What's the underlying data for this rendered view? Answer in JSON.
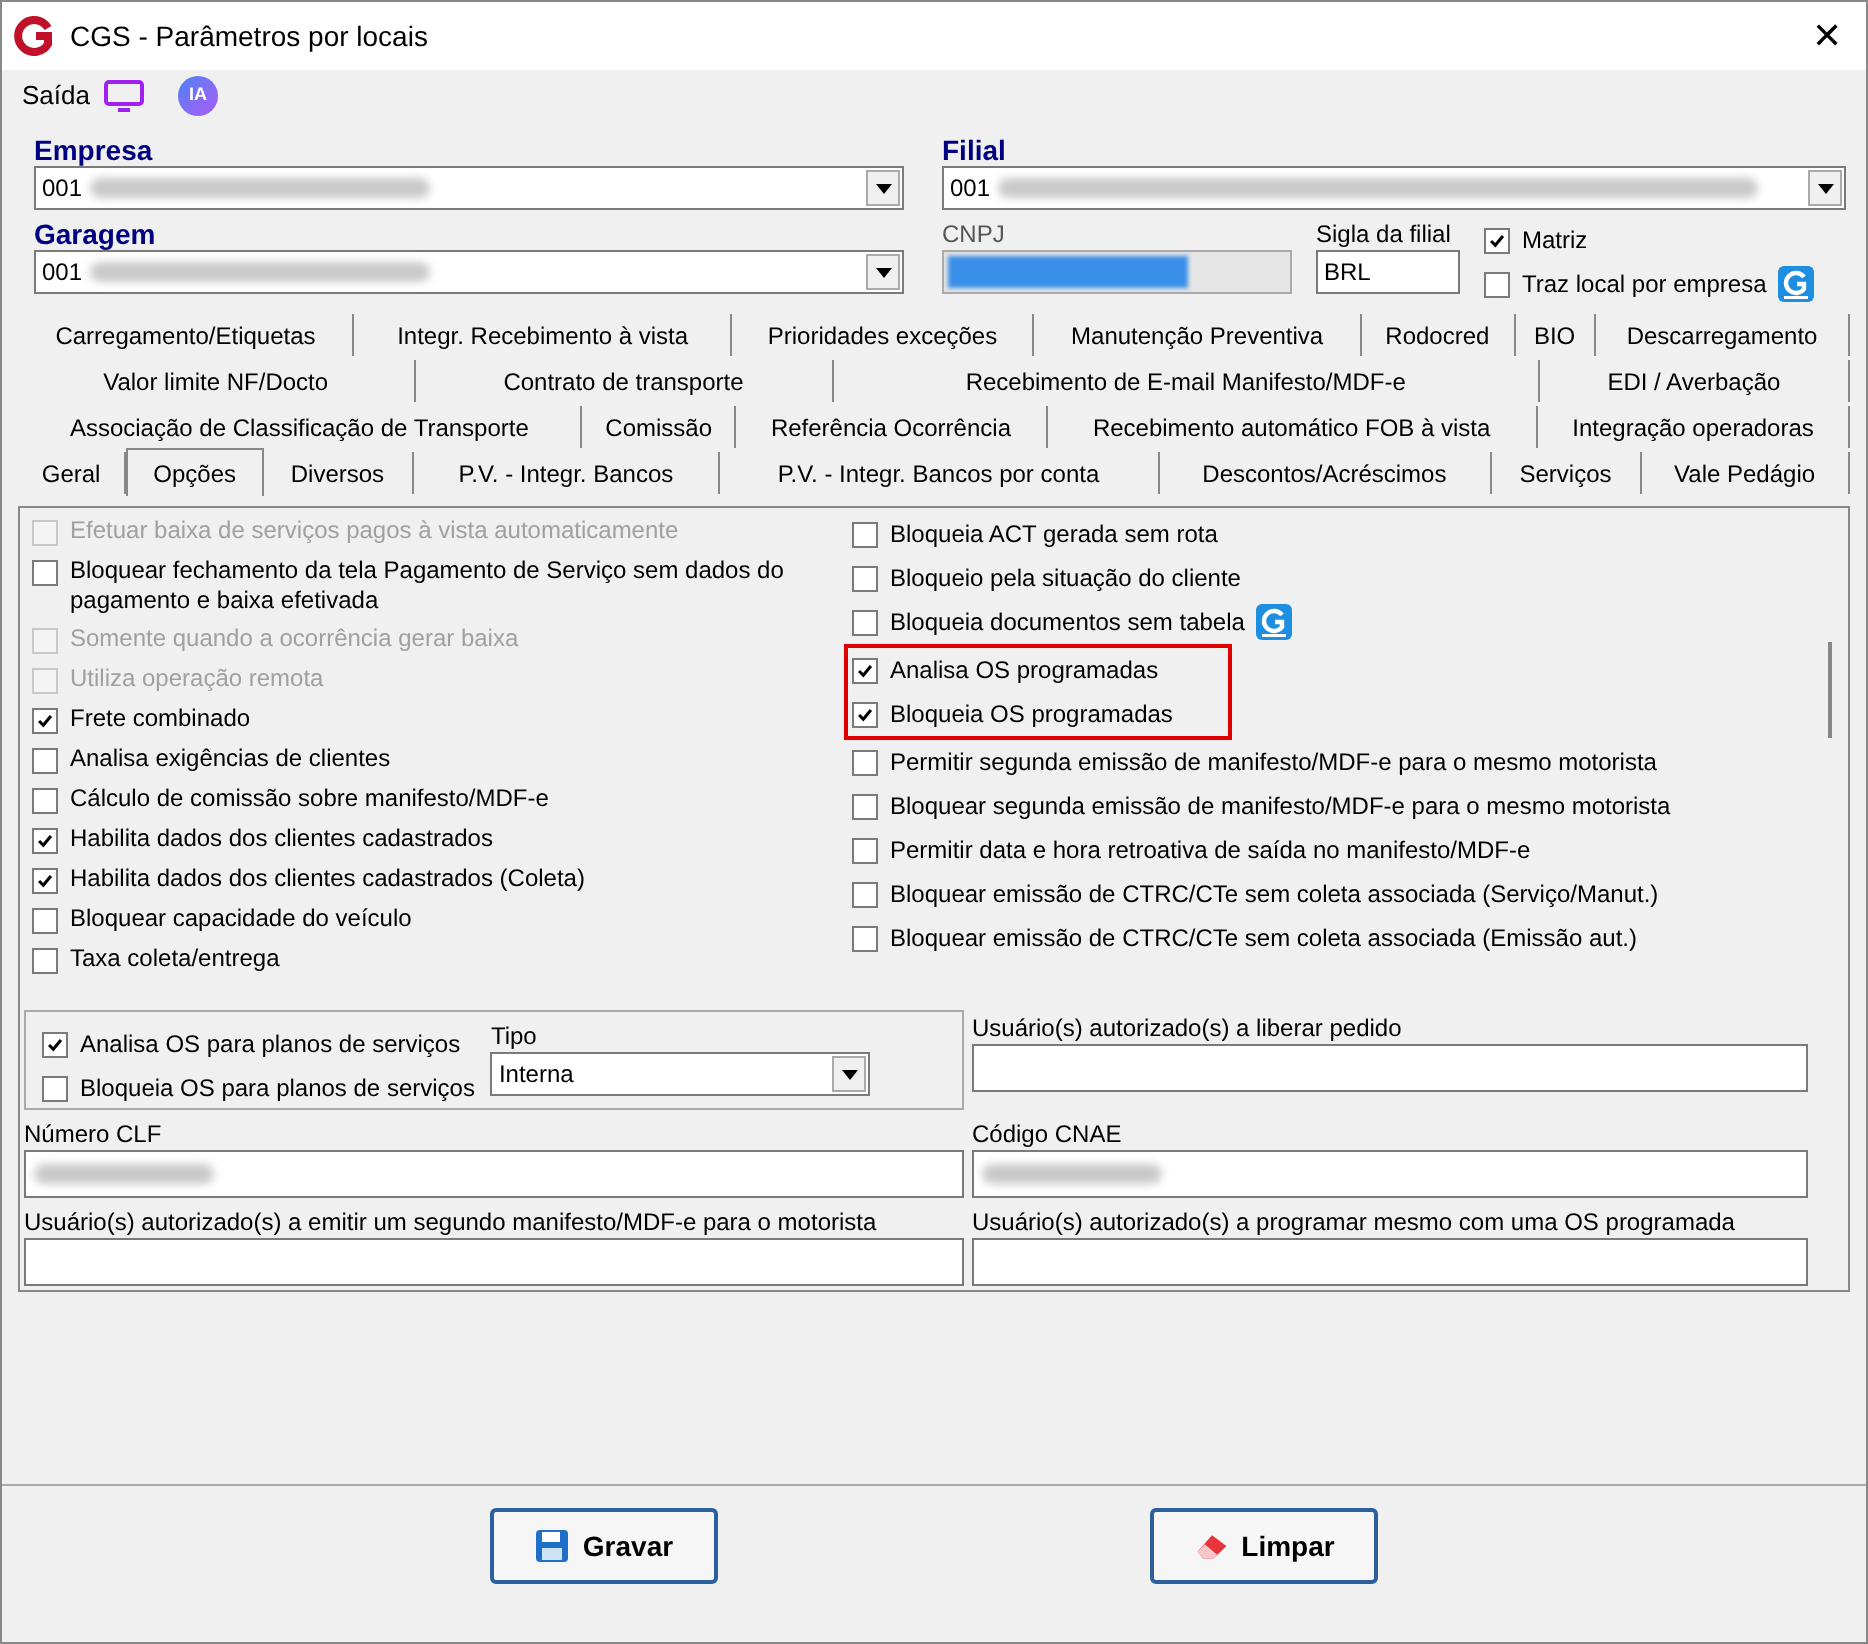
{
  "window": {
    "title": "CGS - Parâmetros por locais",
    "close": "✕"
  },
  "toolbar": {
    "label": "Saída",
    "ia": "IA"
  },
  "fields": {
    "empresa": {
      "label": "Empresa",
      "value": "001"
    },
    "filial": {
      "label": "Filial",
      "value": "001"
    },
    "garagem": {
      "label": "Garagem",
      "value": "001"
    },
    "cnpj": {
      "label": "CNPJ"
    },
    "sigla": {
      "label": "Sigla da filial",
      "value": "BRL"
    },
    "checks": [
      {
        "label": "Matriz",
        "checked": true
      },
      {
        "label": "Traz local por empresa",
        "checked": false
      }
    ]
  },
  "tabs": [
    [
      {
        "label": "Carregamento/Etiquetas",
        "selected": false
      },
      {
        "label": "Integr. Recebimento à vista",
        "selected": false
      },
      {
        "label": "Prioridades exceções",
        "selected": false
      },
      {
        "label": "Manutenção Preventiva",
        "selected": false
      },
      {
        "label": "Rodocred",
        "selected": false
      },
      {
        "label": "BIO",
        "selected": false
      },
      {
        "label": "Descarregamento",
        "selected": false
      }
    ],
    [
      {
        "label": "Valor limite NF/Docto",
        "selected": false
      },
      {
        "label": "Contrato de transporte",
        "selected": false
      },
      {
        "label": "Recebimento de E-mail Manifesto/MDF-e",
        "selected": false
      },
      {
        "label": "EDI / Averbação",
        "selected": false
      }
    ],
    [
      {
        "label": "Associação de Classificação de Transporte",
        "selected": false
      },
      {
        "label": "Comissão",
        "selected": false
      },
      {
        "label": "Referência Ocorrência",
        "selected": false
      },
      {
        "label": "Recebimento automático FOB à vista",
        "selected": false
      },
      {
        "label": "Integração operadoras",
        "selected": false
      }
    ],
    [
      {
        "label": "Geral",
        "selected": false
      },
      {
        "label": "Opções",
        "selected": true
      },
      {
        "label": "Diversos",
        "selected": false
      },
      {
        "label": "P.V. - Integr. Bancos",
        "selected": false
      },
      {
        "label": "P.V. - Integr. Bancos por conta",
        "selected": false
      },
      {
        "label": "Descontos/Acréscimos",
        "selected": false
      },
      {
        "label": "Serviços",
        "selected": false
      },
      {
        "label": "Vale Pedágio",
        "selected": false
      }
    ]
  ],
  "options_left": [
    {
      "label": "Efetuar baixa de serviços pagos à vista automaticamente",
      "checked": false,
      "disabled": true
    },
    {
      "label": "Bloquear fechamento da tela Pagamento de Serviço sem dados do pagamento e baixa efetivada",
      "checked": false,
      "disabled": false
    },
    {
      "label": "Somente quando a ocorrência gerar baixa",
      "checked": false,
      "disabled": true
    },
    {
      "label": "Utiliza operação remota",
      "checked": false,
      "disabled": true
    },
    {
      "label": "Frete combinado",
      "checked": true,
      "disabled": false
    },
    {
      "label": "Analisa exigências de clientes",
      "checked": false,
      "disabled": false
    },
    {
      "label": "Cálculo de comissão sobre manifesto/MDF-e",
      "checked": false,
      "disabled": false
    },
    {
      "label": "Habilita dados dos clientes cadastrados",
      "checked": true,
      "disabled": false
    },
    {
      "label": "Habilita dados dos clientes cadastrados (Coleta)",
      "checked": true,
      "disabled": false
    },
    {
      "label": "Bloquear capacidade do veículo",
      "checked": false,
      "disabled": false
    },
    {
      "label": "Taxa coleta/entrega",
      "checked": false,
      "disabled": false
    }
  ],
  "options_right": [
    {
      "label": "Bloqueia ACT gerada sem rota",
      "checked": false,
      "highlighted": false,
      "badge": false
    },
    {
      "label": "Bloqueio pela situação do cliente",
      "checked": false,
      "highlighted": false,
      "badge": false
    },
    {
      "label": "Bloqueia documentos sem tabela",
      "checked": false,
      "highlighted": false,
      "badge": true
    },
    {
      "label": "Analisa OS programadas",
      "checked": true,
      "highlighted": true,
      "badge": false
    },
    {
      "label": "Bloqueia OS programadas",
      "checked": true,
      "highlighted": true,
      "badge": false
    },
    {
      "label": "Permitir segunda emissão de manifesto/MDF-e para o mesmo motorista",
      "checked": false,
      "highlighted": false,
      "badge": false
    },
    {
      "label": "Bloquear segunda emissão de manifesto/MDF-e para o mesmo motorista",
      "checked": false,
      "highlighted": false,
      "badge": false
    },
    {
      "label": "Permitir data e hora retroativa de saída no manifesto/MDF-e",
      "checked": false,
      "highlighted": false,
      "badge": false
    },
    {
      "label": "Bloquear emissão de CTRC/CTe sem coleta associada (Serviço/Manut.)",
      "checked": false,
      "highlighted": false,
      "badge": false
    },
    {
      "label": "Bloquear emissão de CTRC/CTe sem coleta associada (Emissão aut.)",
      "checked": false,
      "highlighted": false,
      "badge": false
    }
  ],
  "plans": {
    "checks": [
      {
        "label": "Analisa OS para planos de serviços",
        "checked": true
      },
      {
        "label": "Bloqueia OS para planos de serviços",
        "checked": false
      }
    ],
    "tipo": {
      "label": "Tipo",
      "value": "Interna"
    }
  },
  "bottom_fields": [
    {
      "label": "Usuário(s) autorizado(s) a liberar pedido",
      "redacted": false
    },
    {
      "label": "Número CLF",
      "redacted": true
    },
    {
      "label": "Código CNAE",
      "redacted": true
    },
    {
      "label": "Usuário(s) autorizado(s) a emitir um segundo manifesto/MDF-e para o motorista",
      "redacted": false
    },
    {
      "label": "Usuário(s) autorizado(s) a programar mesmo com uma OS programada",
      "redacted": false
    }
  ],
  "buttons": [
    {
      "label": "Gravar",
      "kind": "save"
    },
    {
      "label": "Limpar",
      "kind": "clear"
    }
  ]
}
